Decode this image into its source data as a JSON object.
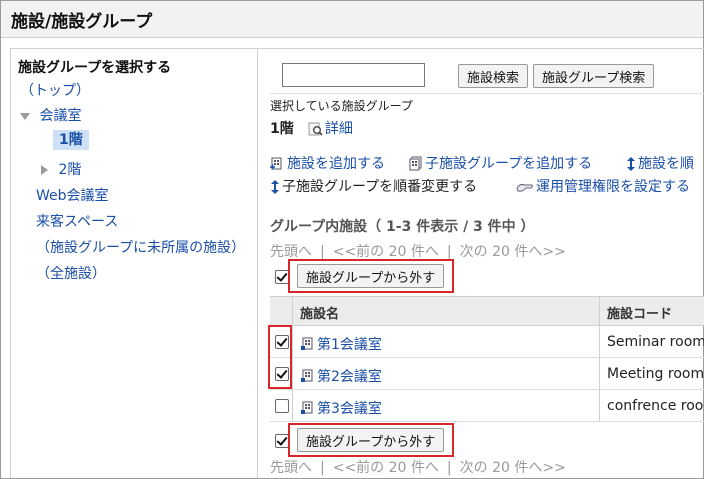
{
  "page": {
    "title": "施設/施設グループ"
  },
  "sidebar": {
    "heading": "施設グループを選択する",
    "top": "（トップ）",
    "items": [
      {
        "label": "会議室",
        "expanded": true
      },
      {
        "label": "1階",
        "selected": true
      },
      {
        "label": "2階",
        "expanded": false
      },
      {
        "label": "Web会議室"
      },
      {
        "label": "来客スペース"
      },
      {
        "label": "（施設グループに未所属の施設）"
      },
      {
        "label": "（全施設）"
      }
    ]
  },
  "search": {
    "value": "",
    "facility_search_label": "施設検索",
    "group_search_label": "施設グループ検索"
  },
  "current_group": {
    "caption": "選択している施設グループ",
    "name": "1階",
    "detail_link": "詳細"
  },
  "actions": {
    "add_facility": "施設を追加する",
    "add_child_group": "子施設グループを追加する",
    "reorder_facilities": "施設を順",
    "reorder_child_groups": "子施設グループを順番変更する",
    "set_admin_rights": "運用管理権限を設定する"
  },
  "list": {
    "title": "グループ内施設（ 1-3 件表示 / 3 件中 ）",
    "pager": {
      "first": "先頭へ",
      "prev": "<<前の 20 件へ",
      "next": "次の 20 件へ>>",
      "separator": "|"
    },
    "remove_button": "施設グループから外す",
    "columns": {
      "name": "施設名",
      "code": "施設コード"
    },
    "rows": [
      {
        "name": "第1会議室",
        "code": "Seminar room",
        "checked": true
      },
      {
        "name": "第2会議室",
        "code": "Meeting room",
        "checked": true
      },
      {
        "name": "第3会議室",
        "code": "confrence roo",
        "checked": false
      }
    ]
  },
  "colors": {
    "link": "#1a4fa8",
    "highlight": "#d9262b",
    "selected_bg": "#cde0f5"
  }
}
